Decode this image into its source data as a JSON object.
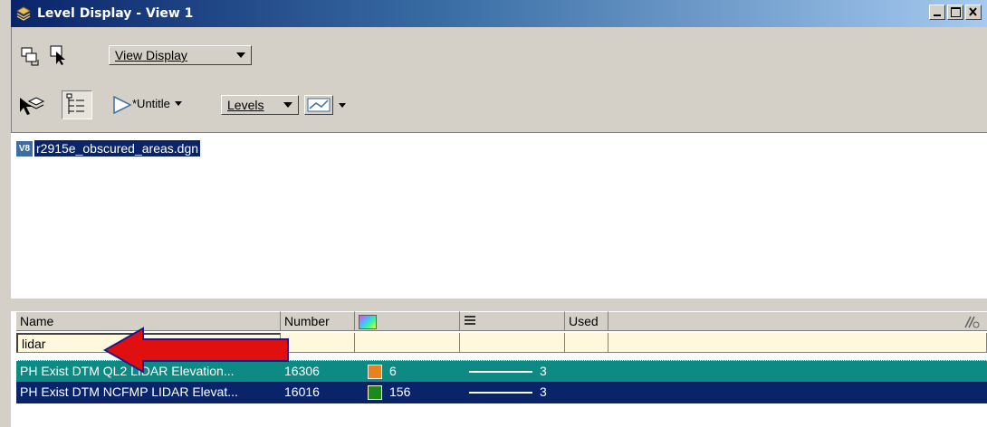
{
  "window": {
    "title": "Level Display - View 1"
  },
  "toolbar1": {
    "view_display_label": "View Display"
  },
  "toolbar2": {
    "file_dropdown_label": "*Untitle",
    "levels_dropdown_label": "Levels"
  },
  "files": [
    {
      "badge": "V8",
      "name": "r2915e_obscured_areas.dgn"
    }
  ],
  "table": {
    "headers": {
      "name": "Name",
      "number": "Number",
      "used": "Used"
    },
    "filter": {
      "name": "lidar"
    },
    "rows": [
      {
        "name": "PH Exist DTM QL2 LIDAR Elevation...",
        "number": "16306",
        "color_index": "6",
        "color": "#e8821e",
        "weight": "3",
        "bg": "#0e8a84"
      },
      {
        "name": "PH Exist DTM NCFMP LIDAR Elevat...",
        "number": "16016",
        "color_index": "156",
        "color": "#1a8a1a",
        "weight": "3",
        "bg": "#0a246a"
      }
    ]
  },
  "colors": {
    "titlebar": "#0a246a",
    "selection": "#0a246a",
    "row_teal": "#0e8a84",
    "arrow": "#e11010"
  }
}
